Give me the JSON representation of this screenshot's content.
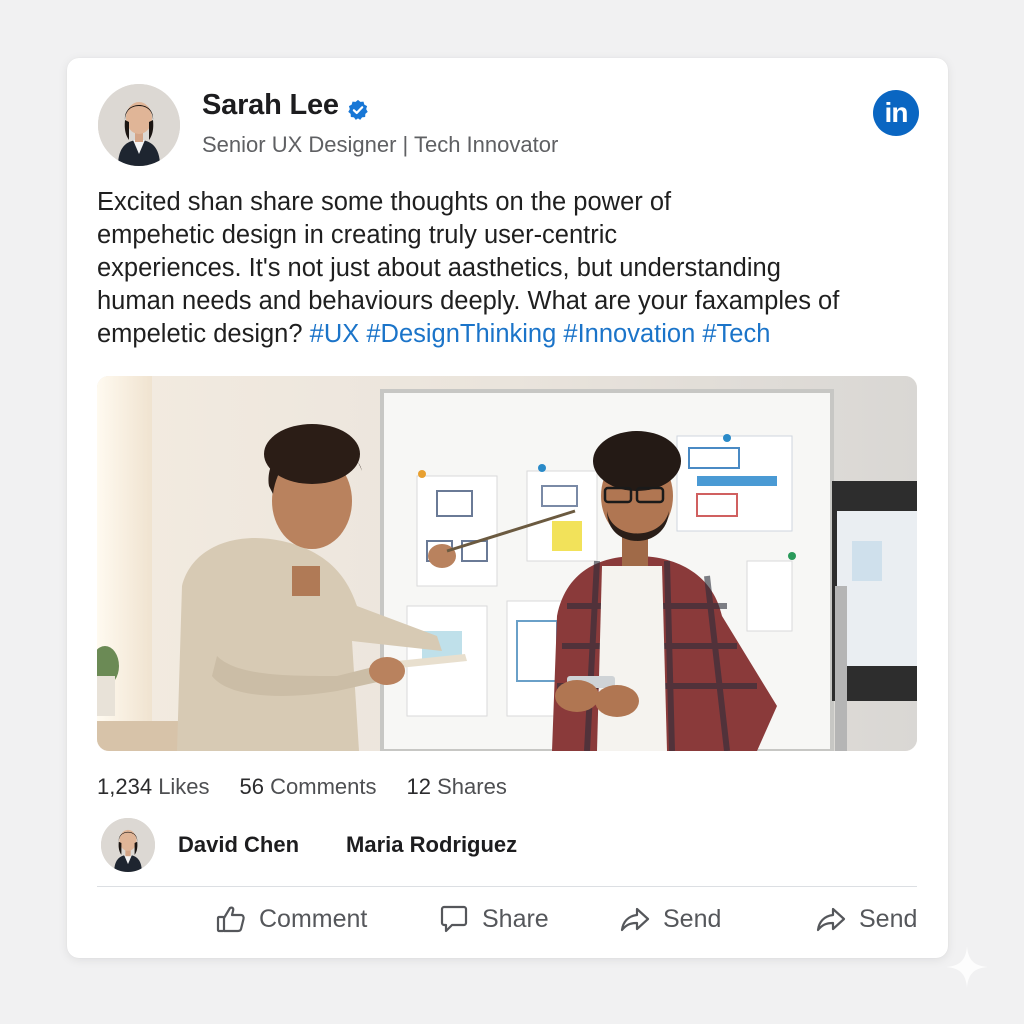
{
  "post": {
    "author": {
      "name": "Sarah Lee",
      "headline": "Senior UX Designer | Tech Innovator",
      "verified_icon": "verified-check-icon"
    },
    "brand_logo": "in",
    "text_lines": [
      "Excited shan share some thoughts on the power of",
      "empehetic design in creating truly user-centric",
      "experiences. It's not just about aasthetics, but understanding",
      "human needs and behaviours deeply. What are your faxamples of",
      "empeletic design?"
    ],
    "hashtags": [
      "#UX",
      "#DesignThinking",
      "#Innovation",
      "#Tech"
    ],
    "image_description_icon": "post-photo"
  },
  "stats": {
    "likes": "1,234",
    "likes_label": "Likes",
    "comments": "56",
    "comments_label": "Comments",
    "shares": "12",
    "shares_label": "Shares"
  },
  "commenters": [
    "David Chen",
    "Maria Rodriguez"
  ],
  "actions": {
    "comment": "Comment",
    "share": "Share",
    "send_1": "Send",
    "send_2": "Send"
  },
  "colors": {
    "brand": "#0a66c2",
    "hashtag": "#1b74c9",
    "verified": "#0a66c2"
  }
}
